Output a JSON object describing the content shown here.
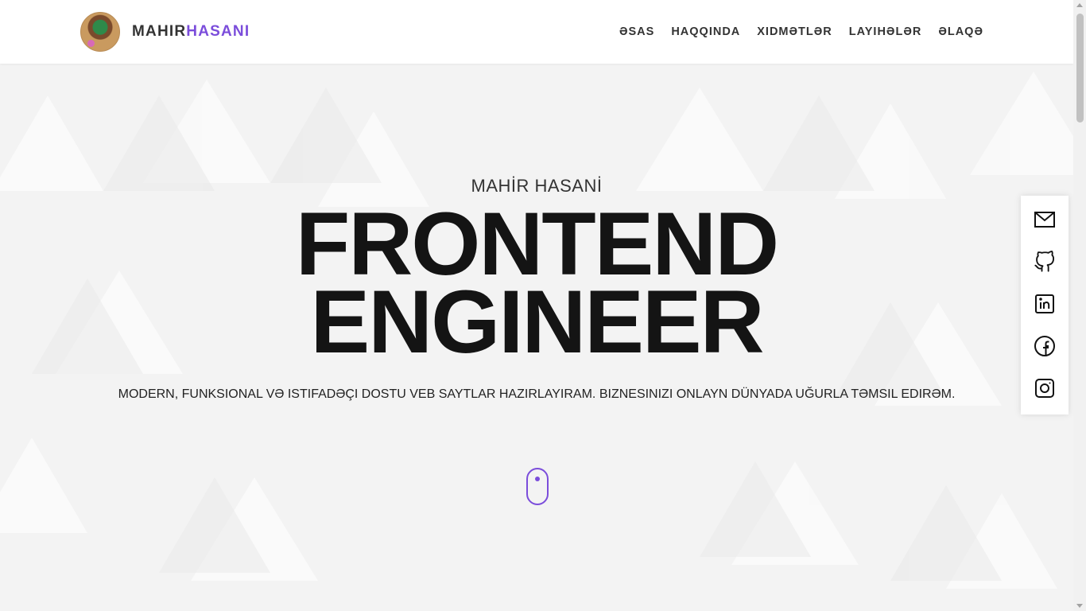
{
  "header": {
    "brand_first": "MAHIR",
    "brand_second": "HASANI",
    "nav": [
      {
        "label": "ƏSAS"
      },
      {
        "label": "HAQQINDA"
      },
      {
        "label": "XIDMƏTLƏR"
      },
      {
        "label": "LAYIHƏLƏR"
      },
      {
        "label": "ƏLAQƏ"
      }
    ]
  },
  "hero": {
    "name": "MAHİR HASANİ",
    "title_line1": "FRONTEND",
    "title_line2": "ENGINEER",
    "description": "MODERN, FUNKSIONAL VƏ ISTIFADƏÇI DOSTU VEB SAYTLAR HAZIRLAYIRAM. BIZNESINIZI ONLAYN DÜNYADA UĞURLA TƏMSIL EDIRƏM."
  },
  "social": [
    {
      "icon": "mail-icon"
    },
    {
      "icon": "github-icon"
    },
    {
      "icon": "linkedin-icon"
    },
    {
      "icon": "facebook-icon"
    },
    {
      "icon": "instagram-icon"
    }
  ],
  "colors": {
    "accent": "#7b4ddb",
    "text_dark": "#141414",
    "background": "#f3f3f3"
  }
}
